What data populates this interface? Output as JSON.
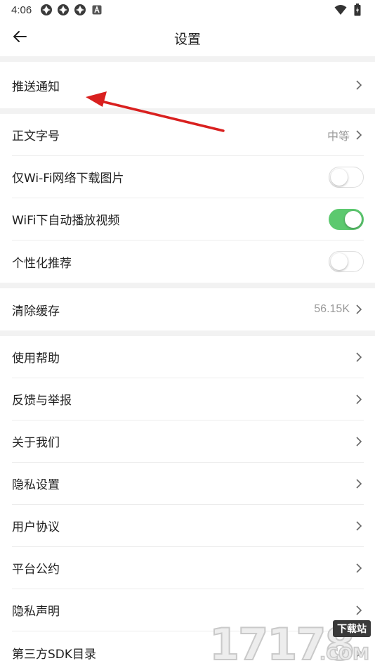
{
  "status_bar": {
    "time": "4:06",
    "notification_icons": [
      "app-icon",
      "app-icon",
      "app-icon",
      "a-icon"
    ],
    "wifi_icon": "wifi-icon",
    "battery_icon": "battery-icon"
  },
  "app_bar": {
    "back_icon": "back-arrow-icon",
    "title": "设置"
  },
  "sections": {
    "push": {
      "push_notification": "推送通知"
    },
    "display": {
      "font_size": {
        "label": "正文字号",
        "value": "中等"
      },
      "wifi_images": {
        "label": "仅Wi-Fi网络下载图片",
        "enabled": false
      },
      "wifi_autoplay": {
        "label": "WiFi下自动播放视频",
        "enabled": true
      },
      "personalized": {
        "label": "个性化推荐",
        "enabled": false
      }
    },
    "cache": {
      "label": "清除缓存",
      "value": "56.15K"
    },
    "about": {
      "help": "使用帮助",
      "feedback": "反馈与举报",
      "about_us": "关于我们",
      "privacy_settings": "隐私设置",
      "user_agreement": "用户协议",
      "platform_rules": "平台公约",
      "privacy_statement": "隐私声明",
      "sdk_list": "第三方SDK目录"
    }
  },
  "colors": {
    "toggle_on": "#5cc96f",
    "annotation_arrow": "#d9201f",
    "section_gap": "#f2f2f2"
  },
  "watermark": {
    "digits": "17178",
    "badge": "下载站",
    "suffix": ".COM"
  }
}
